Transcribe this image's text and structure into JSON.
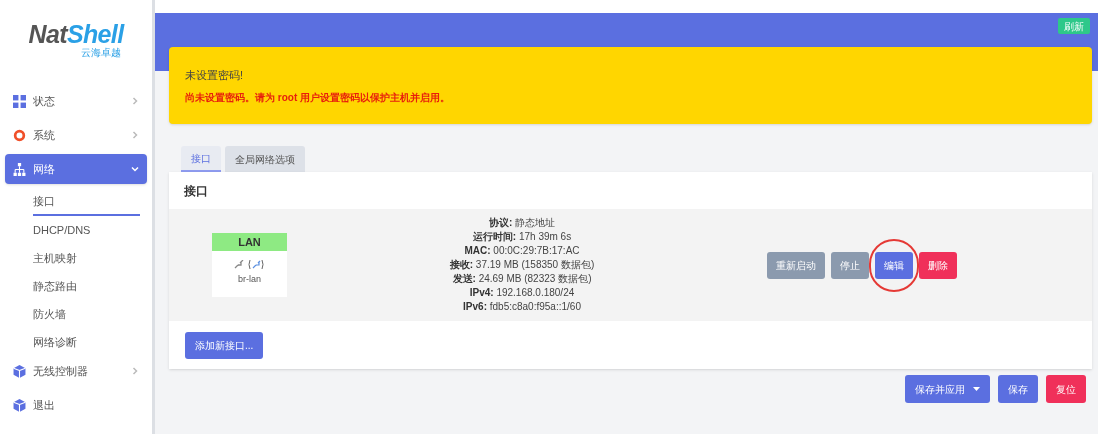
{
  "logo": {
    "brand_dark": "Nat",
    "brand_blue": "Shell",
    "tagline": "云海卓越"
  },
  "header": {
    "refresh_button": "刷新"
  },
  "sidebar": {
    "items": [
      {
        "label": "状态",
        "kind": "group",
        "expanded": false,
        "selected": false
      },
      {
        "label": "系统",
        "kind": "group",
        "expanded": false,
        "selected": false
      },
      {
        "label": "网络",
        "kind": "group",
        "expanded": true,
        "selected": true,
        "children": [
          {
            "label": "接口",
            "selected": true
          },
          {
            "label": "DHCP/DNS",
            "selected": false
          },
          {
            "label": "主机映射",
            "selected": false
          },
          {
            "label": "静态路由",
            "selected": false
          },
          {
            "label": "防火墙",
            "selected": false
          },
          {
            "label": "网络诊断",
            "selected": false
          }
        ]
      },
      {
        "label": "无线控制器",
        "kind": "group",
        "expanded": false,
        "selected": false
      },
      {
        "label": "退出",
        "kind": "link",
        "expanded": false,
        "selected": false
      }
    ]
  },
  "alert": {
    "title": "未设置密码!",
    "message": "尚未设置密码。请为 root 用户设置密码以保护主机并启用。"
  },
  "tabs": [
    {
      "label": "接口",
      "selected": true
    },
    {
      "label": "全局网络选项",
      "selected": false
    }
  ],
  "section": {
    "title": "接口",
    "interfaces": [
      {
        "name": "LAN",
        "device": "br-lan",
        "details": [
          {
            "label": "协议:",
            "value": "静态地址"
          },
          {
            "label": "运行时间:",
            "value": "17h 39m 6s"
          },
          {
            "label": "MAC:",
            "value": "00:0C:29:7B:17:AC"
          },
          {
            "label": "接收:",
            "value": "37.19 MB (158350 数据包)"
          },
          {
            "label": "发送:",
            "value": "24.69 MB (82323 数据包)"
          },
          {
            "label": "IPv4:",
            "value": "192.168.0.180/24"
          },
          {
            "label": "IPv6:",
            "value": "fdb5:c8a0:f95a::1/60"
          }
        ],
        "actions": [
          {
            "label": "重新启动",
            "kind": "neutral",
            "highlighted": false
          },
          {
            "label": "停止",
            "kind": "neutral",
            "highlighted": false
          },
          {
            "label": "编辑",
            "kind": "primary",
            "highlighted": true
          },
          {
            "label": "删除",
            "kind": "danger",
            "highlighted": false
          }
        ]
      }
    ],
    "add_button": "添加新接口..."
  },
  "footer_buttons": [
    {
      "label": "保存并应用",
      "kind": "primary",
      "dropdown": true
    },
    {
      "label": "保存",
      "kind": "primary",
      "dropdown": false
    },
    {
      "label": "复位",
      "kind": "danger",
      "dropdown": false
    }
  ]
}
